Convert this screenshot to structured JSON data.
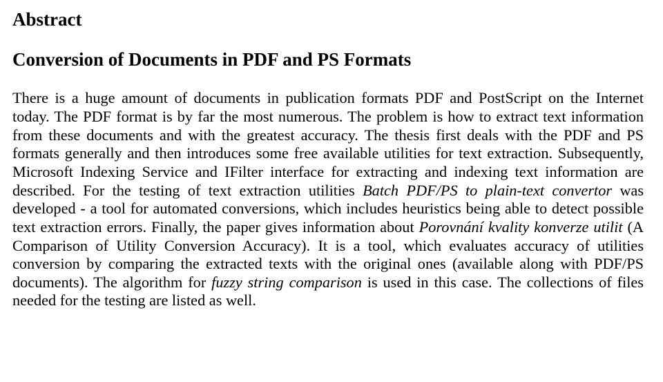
{
  "abstract_label": "Abstract",
  "title": "Conversion of Documents in PDF and PS Formats",
  "body": {
    "seg1": "There is a huge amount of documents in publication formats PDF and PostScript on the Internet today. The PDF format is by far the most numerous. The problem is how to extract text information from these documents and with the greatest accuracy. The thesis first deals with the PDF and PS formats generally and then introduces some free available utilities for text extraction. Subsequently, Microsoft Indexing Service and IFilter interface for extracting and indexing text information are described. For the testing of text extraction utilities ",
    "italic1": "Batch PDF/PS to plain-text convertor",
    "seg2": " was developed - a tool for automated conversions, which includes heuristics being able to detect possible text extraction errors. Finally, the paper gives information about ",
    "italic2": "Porovnání kvality konverze utilit",
    "seg3": " (A Comparison of Utility Conversion Accuracy). It is a tool, which evaluates accuracy of utilities conversion by comparing the extracted texts with the original ones (available along with PDF/PS documents). The algorithm for ",
    "italic3": "fuzzy string comparison",
    "seg4": " is used in this case. The collections of files needed for the testing are listed as well."
  }
}
